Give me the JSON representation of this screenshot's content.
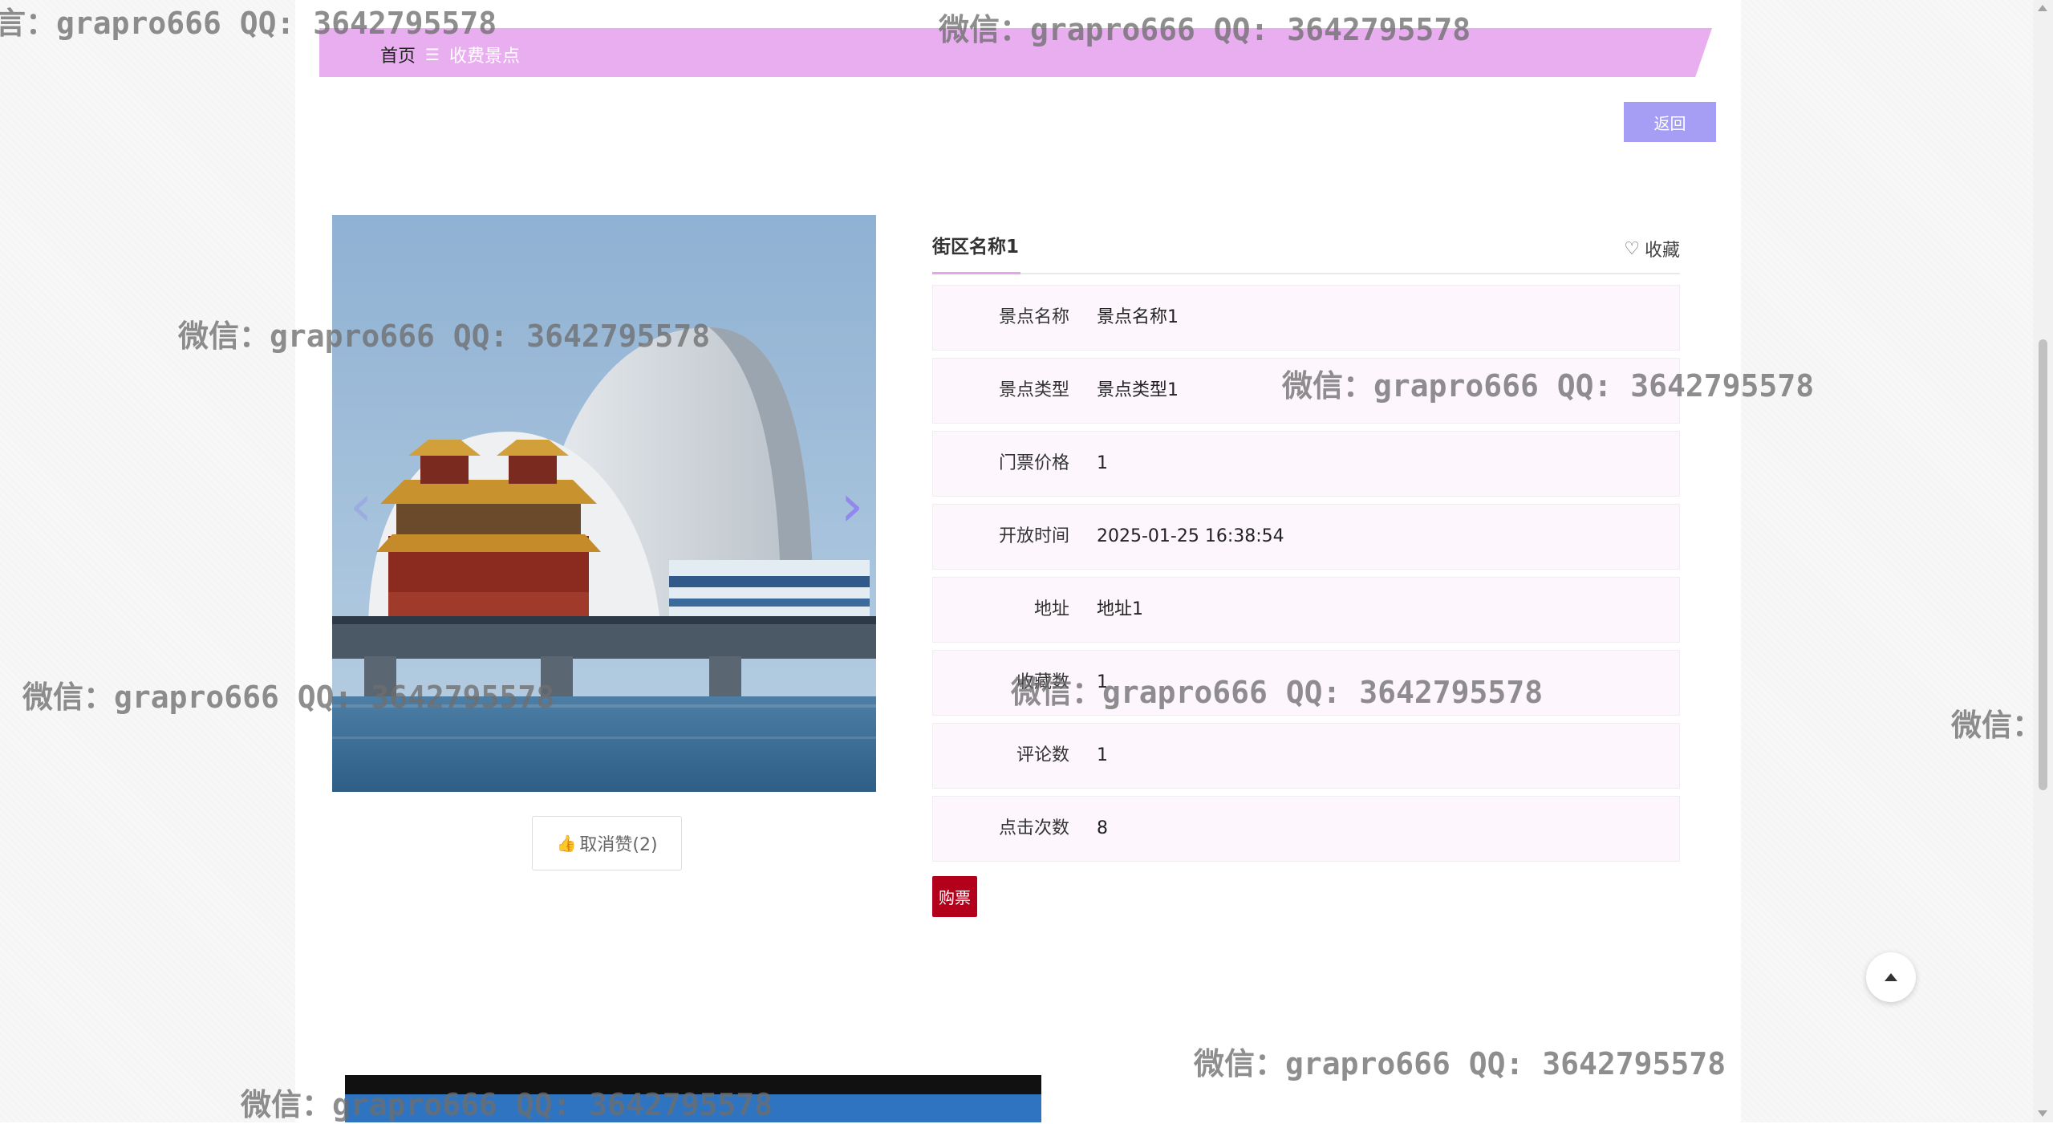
{
  "breadcrumb": {
    "home": "首页",
    "separator": "☰",
    "current": "收费景点"
  },
  "actions": {
    "back_label": "返回",
    "like_label": "取消赞(2)",
    "favorite_label": "收藏",
    "buy_label": "购票"
  },
  "detail": {
    "title": "街区名称1",
    "fields": [
      {
        "label": "景点名称",
        "value": "景点名称1"
      },
      {
        "label": "景点类型",
        "value": "景点类型1"
      },
      {
        "label": "门票价格",
        "value": "1"
      },
      {
        "label": "开放时间",
        "value": "2025-01-25 16:38:54"
      },
      {
        "label": "地址",
        "value": "地址1"
      },
      {
        "label": "收藏数",
        "value": "1"
      },
      {
        "label": "评论数",
        "value": "1"
      },
      {
        "label": "点击次数",
        "value": "8"
      }
    ]
  },
  "watermark": {
    "text": "微信：grapro666 QQ: 3642795578",
    "text_cut_left": "言：grapro666 QQ: 3642795578",
    "text_cut_right": "微信："
  },
  "colors": {
    "banner": "#e9aef0",
    "back_button": "#a69ef5",
    "buy_button": "#b3001b",
    "tab_underline": "#e3a6e8",
    "row_background": "#fdf7fd"
  },
  "icons": {
    "like": "thumbs-up-icon",
    "favorite": "heart-outline-icon",
    "back_to_top": "caret-up-icon",
    "carousel_prev": "chevron-left-icon",
    "carousel_next": "chevron-right-icon"
  }
}
